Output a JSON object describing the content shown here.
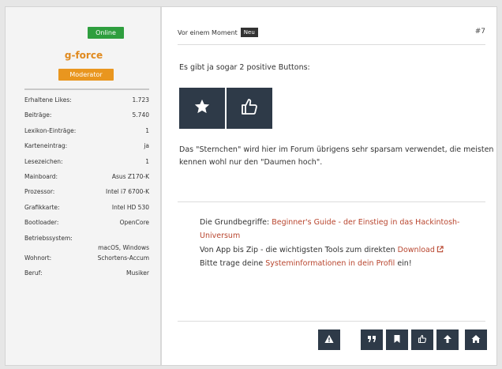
{
  "profile": {
    "status": "Online",
    "username": "g-force",
    "rank": "Moderator",
    "stats": [
      {
        "label": "Erhaltene Likes:",
        "value": "1.723"
      },
      {
        "label": "Beiträge:",
        "value": "5.740"
      },
      {
        "label": "Lexikon-Einträge:",
        "value": "1"
      },
      {
        "label": "Karteneintrag:",
        "value": "ja"
      },
      {
        "label": "Lesezeichen:",
        "value": "1"
      },
      {
        "label": "Mainboard:",
        "value": "Asus Z170-K"
      },
      {
        "label": "Prozessor:",
        "value": "Intel i7 6700-K"
      },
      {
        "label": "Grafikkarte:",
        "value": "Intel HD 530"
      },
      {
        "label": "Bootloader:",
        "value": "OpenCore"
      },
      {
        "label": "Betriebssystem:",
        "value": "macOS, Windows"
      },
      {
        "label": "Wohnort:",
        "value": "Schortens-Accum"
      },
      {
        "label": "Beruf:",
        "value": "Musiker"
      }
    ]
  },
  "post": {
    "time": "Vor einem Moment",
    "badge": "Neu",
    "number": "#7",
    "paragraph1": "Es gibt ja sogar 2 positive Buttons:",
    "paragraph2": "Das \"Sternchen\" wird hier im Forum übrigens sehr sparsam verwendet, die meisten kennen wohl nur den \"Daumen hoch\"."
  },
  "signature": {
    "l1_text": "Die Grundbegriffe: ",
    "l1_link": "Beginner's Guide - der Einstieg in das Hackintosh-Universum",
    "l2_text": "Von App bis Zip - die wichtigsten Tools zum direkten ",
    "l2_link": "Download",
    "l3_text": "Bitte trage deine ",
    "l3_link": "Systeminformationen in dein Profil",
    "l3_end": " ein!"
  },
  "colors": {
    "online": "#2e9e3e",
    "username": "#e08a1f",
    "rank": "#e9961f",
    "button": "#2e3a48",
    "link": "#b8452e"
  },
  "icons": [
    "star-icon",
    "thumbs-up-icon",
    "warning-icon",
    "quote-icon",
    "bookmark-icon",
    "like-icon",
    "arrow-up-icon",
    "home-icon",
    "external-link-icon"
  ]
}
